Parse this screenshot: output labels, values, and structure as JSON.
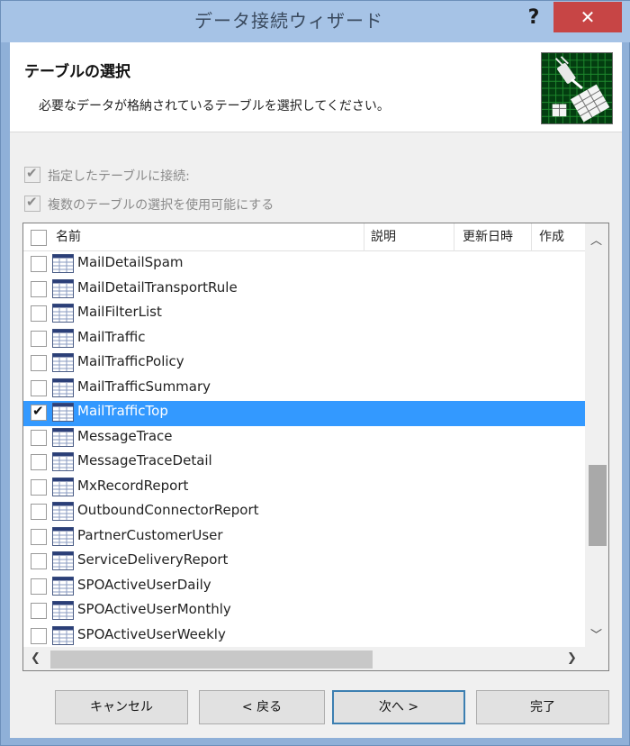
{
  "window": {
    "title": "データ接続ウィザード",
    "help": "?",
    "close": "✕"
  },
  "header": {
    "title": "テーブルの選択",
    "description": "必要なデータが格納されているテーブルを選択してください。"
  },
  "options": [
    {
      "label": "指定したテーブルに接続:",
      "checked": true,
      "disabled": true
    },
    {
      "label": "複数のテーブルの選択を使用可能にする",
      "checked": true,
      "disabled": true
    }
  ],
  "table": {
    "columns": [
      "名前",
      "説明",
      "更新日時",
      "作成"
    ],
    "rows": [
      {
        "name": "MailDetailSpam",
        "checked": false,
        "selected": false
      },
      {
        "name": "MailDetailTransportRule",
        "checked": false,
        "selected": false
      },
      {
        "name": "MailFilterList",
        "checked": false,
        "selected": false
      },
      {
        "name": "MailTraffic",
        "checked": false,
        "selected": false
      },
      {
        "name": "MailTrafficPolicy",
        "checked": false,
        "selected": false
      },
      {
        "name": "MailTrafficSummary",
        "checked": false,
        "selected": false
      },
      {
        "name": "MailTrafficTop",
        "checked": true,
        "selected": true
      },
      {
        "name": "MessageTrace",
        "checked": false,
        "selected": false
      },
      {
        "name": "MessageTraceDetail",
        "checked": false,
        "selected": false
      },
      {
        "name": "MxRecordReport",
        "checked": false,
        "selected": false
      },
      {
        "name": "OutboundConnectorReport",
        "checked": false,
        "selected": false
      },
      {
        "name": "PartnerCustomerUser",
        "checked": false,
        "selected": false
      },
      {
        "name": "ServiceDeliveryReport",
        "checked": false,
        "selected": false
      },
      {
        "name": "SPOActiveUserDaily",
        "checked": false,
        "selected": false
      },
      {
        "name": "SPOActiveUserMonthly",
        "checked": false,
        "selected": false
      },
      {
        "name": "SPOActiveUserWeekly",
        "checked": false,
        "selected": false
      }
    ]
  },
  "buttons": {
    "cancel": "キャンセル",
    "back": "< 戻る",
    "next": "次へ >",
    "finish": "完了"
  },
  "colors": {
    "selection": "#3399ff",
    "close": "#c74545",
    "titlebar": "#a6c3e6"
  }
}
